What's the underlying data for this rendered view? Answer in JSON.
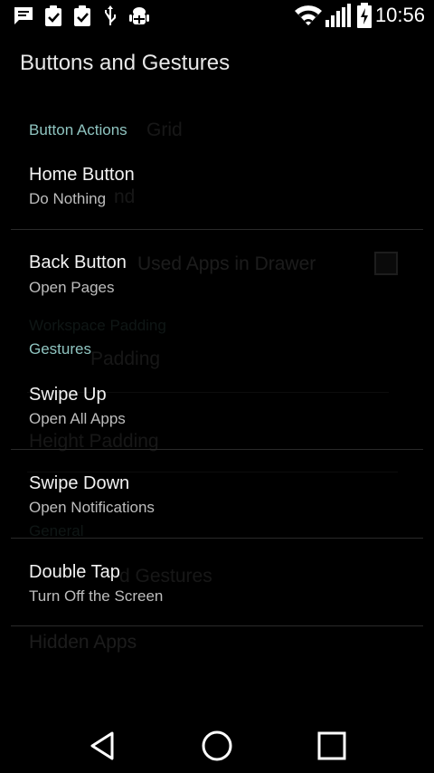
{
  "status_bar": {
    "time": "10:56",
    "icons": [
      "message-icon",
      "clipboard-check-icon",
      "clipboard-check-icon",
      "usb-icon",
      "android-debug-icon",
      "wifi-icon",
      "signal-icon",
      "battery-charging-icon"
    ]
  },
  "header": {
    "title": "Buttons and Gestures"
  },
  "sections": [
    {
      "header": "Button Actions",
      "items": [
        {
          "title": "Home Button",
          "summary": "Do Nothing"
        },
        {
          "title": "Back Button",
          "summary": "Open Pages"
        }
      ]
    },
    {
      "header": "Gestures",
      "items": [
        {
          "title": "Swipe Up",
          "summary": "Open All Apps"
        },
        {
          "title": "Swipe Down",
          "summary": "Open Notifications"
        },
        {
          "title": "Double Tap",
          "summary": "Turn Off the Screen"
        }
      ]
    }
  ],
  "background_ghost": {
    "lines": [
      "Grid",
      "nd",
      "Used Apps in Drawer",
      "Workspace Padding",
      "Padding",
      "Height Padding",
      "General",
      "d Gestures",
      "Hidden Apps"
    ]
  },
  "nav_bar": {
    "icons": [
      "back-icon",
      "home-icon",
      "recents-icon"
    ]
  },
  "colors": {
    "accent": "#8fc4c0",
    "background": "#000000",
    "text_primary": "#f2f2f2",
    "text_secondary": "#bdbdbd"
  }
}
